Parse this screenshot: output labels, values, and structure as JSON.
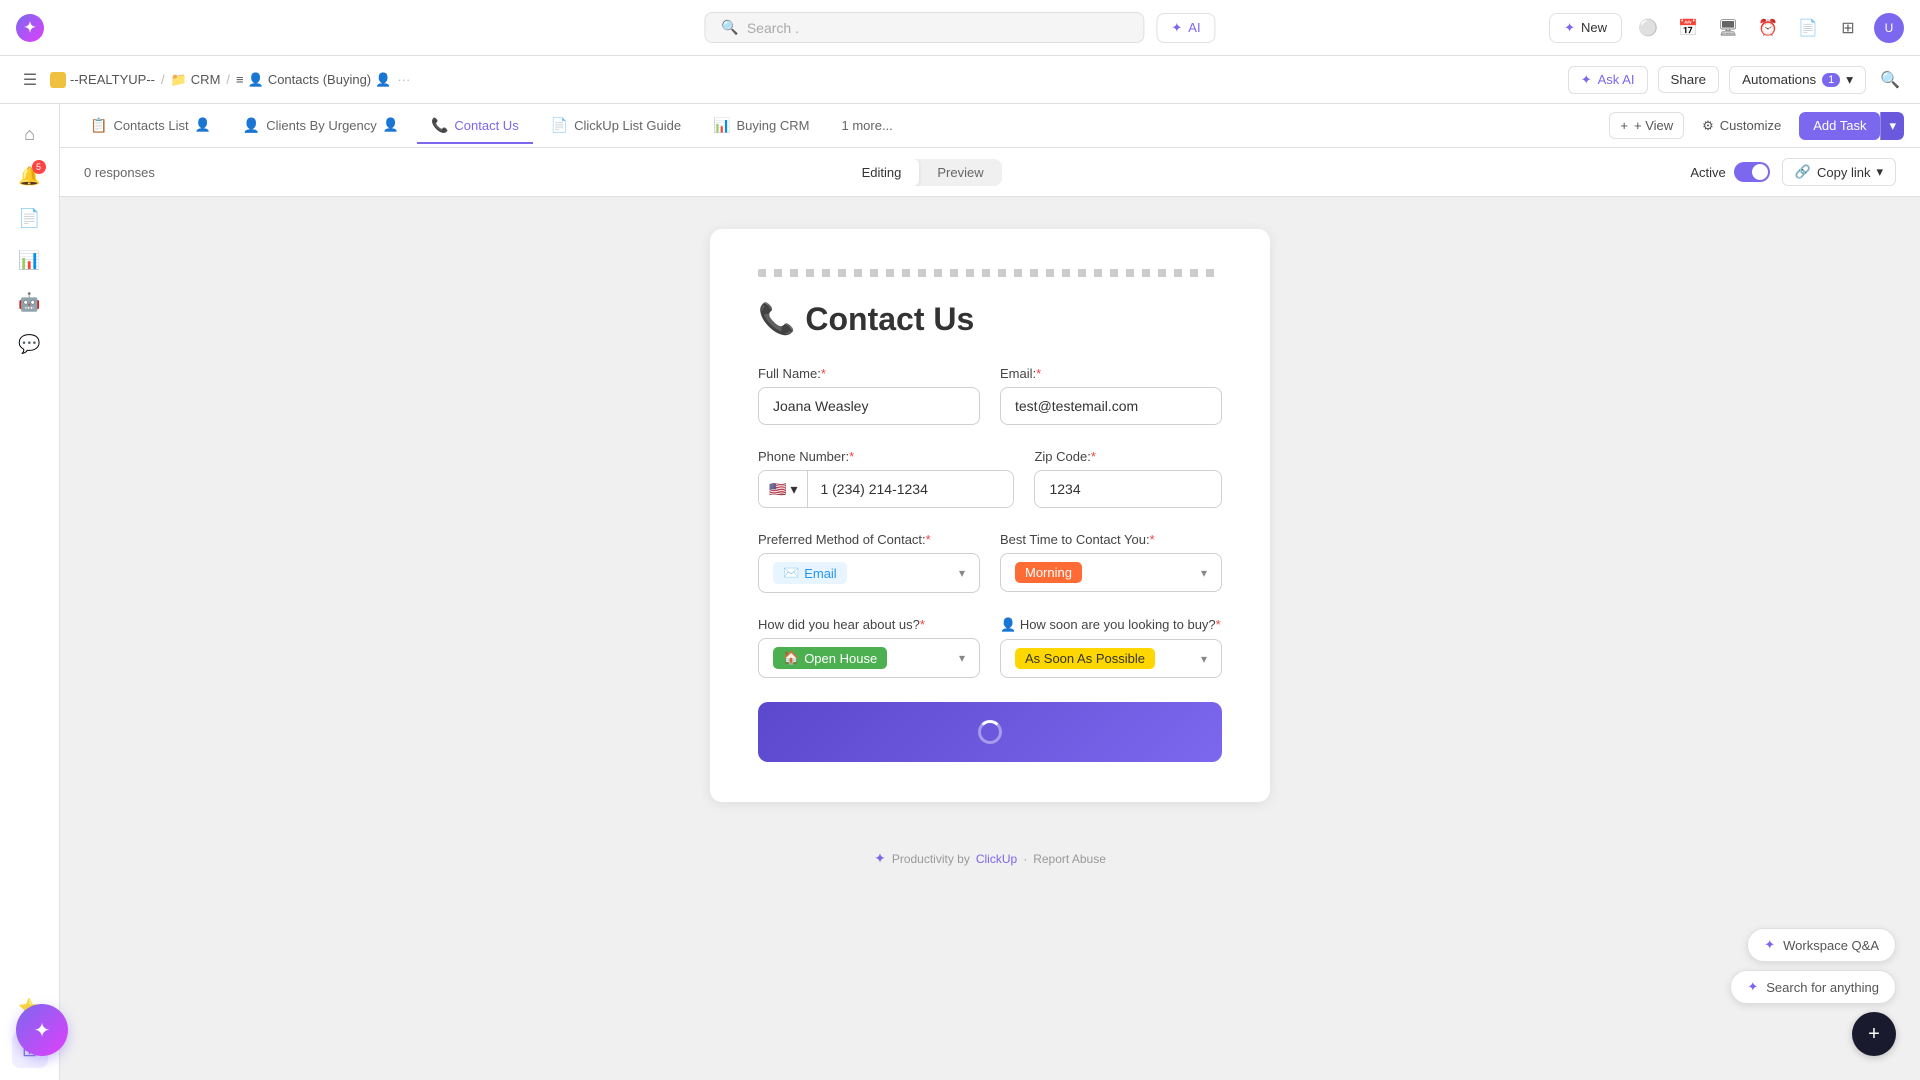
{
  "topbar": {
    "search_placeholder": "Search  .",
    "ai_label": "AI",
    "new_label": "New",
    "avatar_initials": "U"
  },
  "breadcrumb": {
    "workspace": "--REALTYUP--",
    "crm": "CRM",
    "list": "Contacts (Buying)",
    "ask_ai": "Ask AI",
    "share": "Share",
    "automations": "Automations",
    "automations_count": "1"
  },
  "tabs": [
    {
      "id": "contacts-list",
      "label": "Contacts List",
      "icon": "📋",
      "active": false
    },
    {
      "id": "clients-by-urgency",
      "label": "Clients By Urgency",
      "icon": "👤",
      "active": false
    },
    {
      "id": "contact-us",
      "label": "Contact Us",
      "icon": "📞",
      "active": true
    },
    {
      "id": "clickup-list-guide",
      "label": "ClickUp List Guide",
      "icon": "📄",
      "active": false
    },
    {
      "id": "buying-crm",
      "label": "Buying CRM",
      "icon": "📊",
      "active": false
    },
    {
      "id": "more",
      "label": "1 more...",
      "icon": "",
      "active": false
    },
    {
      "id": "view",
      "label": "+ View",
      "icon": "",
      "active": false
    }
  ],
  "toolbar": {
    "responses_label": "0 responses",
    "editing_label": "Editing",
    "preview_label": "Preview",
    "active_label": "Active",
    "copy_link_label": "Copy link"
  },
  "form": {
    "title": "Contact Us",
    "title_icon": "📞",
    "full_name_label": "Full Name:",
    "full_name_value": "Joana Weasley",
    "email_label": "Email:",
    "email_value": "test@testemail.com",
    "phone_label": "Phone Number:",
    "phone_country": "🇺🇸",
    "phone_value": "1 (234) 214-1234",
    "zip_label": "Zip Code:",
    "zip_value": "1234",
    "contact_method_label": "Preferred Method of Contact:",
    "contact_method_value": "Email",
    "contact_method_icon": "✉️",
    "best_time_label": "Best Time to Contact You:",
    "best_time_value": "Morning",
    "hear_about_label": "How did you hear about us?",
    "hear_about_value": "Open House",
    "hear_about_icon": "🏠",
    "buy_soon_label": "How soon are you looking to buy?",
    "buy_soon_value": "As Soon As Possible"
  },
  "footer": {
    "powered_by": "Productivity by",
    "clickup": "ClickUp",
    "separator": "·",
    "report": "Report Abuse"
  },
  "helpers": {
    "workspace_qa": "Workspace Q&A",
    "search_anything": "Search for anything",
    "plus_icon": "+"
  },
  "sidebar": {
    "items": [
      {
        "id": "home",
        "icon": "⌂",
        "active": false
      },
      {
        "id": "inbox",
        "icon": "🔔",
        "active": false,
        "badge": "5"
      },
      {
        "id": "docs",
        "icon": "📄",
        "active": false
      },
      {
        "id": "dashboard",
        "icon": "📊",
        "active": false
      },
      {
        "id": "ai",
        "icon": "🤖",
        "active": false
      },
      {
        "id": "chat",
        "icon": "💬",
        "active": false
      },
      {
        "id": "favorites",
        "icon": "⭐",
        "active": false
      },
      {
        "id": "apps",
        "icon": "⊞",
        "active": true
      }
    ]
  }
}
